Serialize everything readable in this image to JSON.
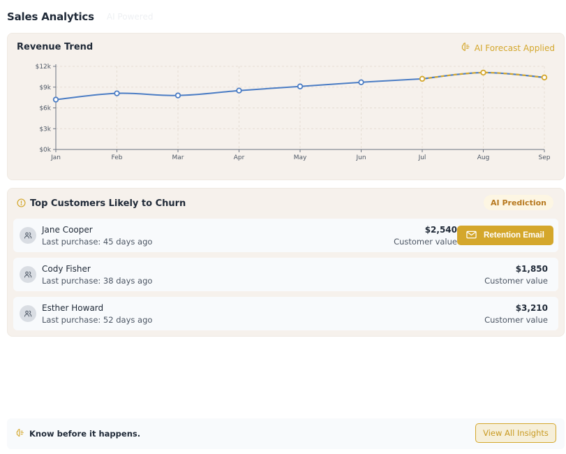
{
  "header": {
    "title": "Sales Analytics",
    "subtitle_badge": "AI Powered"
  },
  "trend": {
    "title": "Revenue Trend",
    "forecast_label": "AI Forecast Applied",
    "icon": "brain-icon",
    "colors": {
      "actual": "#4a7cc4",
      "forecast": "#d4a72c",
      "axis": "#6b7280",
      "grid": "#e5ddd3"
    }
  },
  "chart_data": {
    "type": "line",
    "categories": [
      "Jan",
      "Feb",
      "Mar",
      "Apr",
      "May",
      "Jun",
      "Jul",
      "Aug",
      "Sep"
    ],
    "series": [
      {
        "values": [
          7200,
          8100,
          7800,
          8500,
          9100,
          9700,
          10200,
          null,
          null
        ]
      },
      {
        "values": [
          null,
          null,
          null,
          null,
          null,
          null,
          10200,
          11100,
          10400
        ]
      }
    ],
    "y_ticks": [
      "$0k",
      "$3k",
      "$6k",
      "$9k",
      "$12k"
    ],
    "ylim": [
      0,
      12000
    ],
    "grid": true
  },
  "churn": {
    "title": "Top Customers Likely to Churn",
    "badge": "AI Prediction",
    "icon": "alert-circle-icon",
    "customers": [
      {
        "name": "Jane Cooper",
        "last_purchase": "Last purchase: 45 days ago",
        "amount": "$2,540",
        "value_label": "Customer value"
      },
      {
        "name": "Cody Fisher",
        "last_purchase": "Last purchase: 38 days ago",
        "amount": "$1,850",
        "value_label": "Customer value"
      },
      {
        "name": "Esther Howard",
        "last_purchase": "Last purchase: 52 days ago",
        "amount": "$3,210",
        "value_label": "Customer value"
      }
    ],
    "retention_button": "Retention Email"
  },
  "footer": {
    "tagline": "Know before it happens.",
    "button": "View All Insights"
  }
}
